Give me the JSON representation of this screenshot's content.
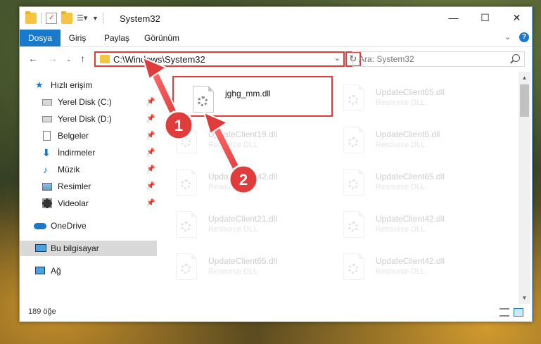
{
  "window": {
    "title": "System32",
    "controls": {
      "minimize": "—",
      "maximize": "☐",
      "close": "✕"
    }
  },
  "ribbon": {
    "tabs": [
      "Dosya",
      "Giriş",
      "Paylaş",
      "Görünüm"
    ]
  },
  "navbar": {
    "address": "C:\\Windows\\System32",
    "search_placeholder": "Ara: System32"
  },
  "sidebar": {
    "quick_access": "Hızlı erişim",
    "items": [
      {
        "label": "Yerel Disk (C:)",
        "icon": "drive-icon"
      },
      {
        "label": "Yerel Disk (D:)",
        "icon": "drive-icon"
      },
      {
        "label": "Belgeler",
        "icon": "documents-icon"
      },
      {
        "label": "İndirmeler",
        "icon": "downloads-icon"
      },
      {
        "label": "Müzik",
        "icon": "music-icon"
      },
      {
        "label": "Resimler",
        "icon": "pictures-icon"
      },
      {
        "label": "Videolar",
        "icon": "videos-icon"
      }
    ],
    "onedrive": "OneDrive",
    "this_pc": "Bu bilgisayar",
    "network": "Ağ"
  },
  "files": {
    "highlighted": {
      "name": "jghg_mm.dll"
    },
    "left": [
      {
        "name": "UpdateClient19.dll",
        "type": "Resource DLL"
      },
      {
        "name": "UpdateClient42.dll",
        "type": "Resource DLL"
      },
      {
        "name": "UpdateClient21.dll",
        "type": "Resource DLL"
      },
      {
        "name": "UpdateClient65.dll",
        "type": "Resource DLL"
      }
    ],
    "right": [
      {
        "name": "UpdateClient65.dll",
        "type": "Resource DLL"
      },
      {
        "name": "UpdateClient5.dll",
        "type": "Resource DLL"
      },
      {
        "name": "UpdateClient65.dll",
        "type": "Resource DLL"
      },
      {
        "name": "UpdateClient42.dll",
        "type": "Resource DLL"
      },
      {
        "name": "UpdateClient42.dll",
        "type": "Resource DLL"
      }
    ]
  },
  "status": {
    "item_count": "189 öğe"
  },
  "annotations": {
    "step1": "1",
    "step2": "2"
  },
  "colors": {
    "accent": "#1979ca",
    "highlight": "#e03c3c",
    "selection": "#cce8ff"
  }
}
